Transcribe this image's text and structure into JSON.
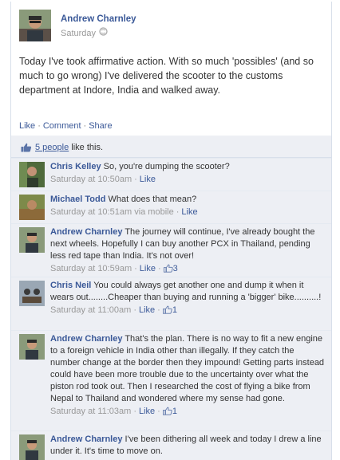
{
  "post": {
    "author": "Andrew Charnley",
    "time": "Saturday",
    "text": "Today I've took affirmative action. With so much 'possibles' (and so much to go wrong) I've delivered the scooter to the customs department at Indore, India and walked away.",
    "actions": {
      "like": "Like",
      "comment": "Comment",
      "share": "Share",
      "sep": "·"
    }
  },
  "likes": {
    "count_link": "5 people",
    "suffix": " like this."
  },
  "comments": [
    {
      "author": "Chris Kelley",
      "text": "So, you're dumping the scooter?",
      "time": "Saturday at 10:50am",
      "like": "Like",
      "likes": "",
      "via": ""
    },
    {
      "author": "Michael Todd",
      "text": "What does that mean?",
      "time": "Saturday at 10:51am",
      "via": "via mobile",
      "like": "Like",
      "likes": ""
    },
    {
      "author": "Andrew Charnley",
      "text": "The journey will continue, I've already bought the next wheels. Hopefully I can buy another PCX in Thailand, pending less red tape than India. It's not over!",
      "time": "Saturday at 10:59am",
      "via": "",
      "like": "Like",
      "likes": "3"
    },
    {
      "author": "Chris Neil",
      "text": "You could always get another one and dump it when it wears out........Cheaper than buying and running a 'bigger' bike..........!",
      "time": "Saturday at 11:00am",
      "via": "",
      "like": "Like",
      "likes": "1"
    },
    {
      "author": "Andrew Charnley",
      "text": "That's the plan. There is no way to fit a new engine to a foreign vehicle in India other than illegally. If they catch the number change at the border then they impound! Getting parts instead could have been more trouble due to the uncertainty over what the piston rod took out. Then I researched the cost of flying a bike from Nepal to Thailand and wondered where my sense had gone.",
      "time": "Saturday at 11:03am",
      "via": "",
      "like": "Like",
      "likes": "1"
    },
    {
      "author": "Andrew Charnley",
      "text": "I've been dithering all week and today I drew a line under it. It's time to move on.",
      "time": "",
      "via": "",
      "like": "",
      "likes": ""
    }
  ],
  "colors": {
    "link": "#3b5998",
    "feedback_bg": "#edeff4",
    "meta": "#999999"
  }
}
